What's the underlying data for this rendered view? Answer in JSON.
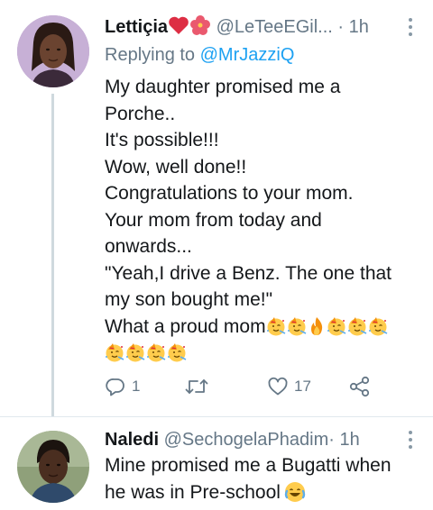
{
  "tweets": [
    {
      "author_name": "Lettiçia",
      "author_name_emojis": [
        "red-heart",
        "hibiscus"
      ],
      "handle": "@LeTeeEGil...",
      "dot": "·",
      "time": "1h",
      "reply_label": "Replying to",
      "reply_mention": "@MrJazziQ",
      "lines": [
        "My daughter promised me a",
        "Porche..",
        "It's possible!!!",
        "Wow, well done!!",
        "Congratulations to your mom.",
        "Your mom from today and",
        "onwards...",
        "\"Yeah,I drive a Benz. The one that",
        "my son bought me!\"",
        "What a proud mom"
      ],
      "line_end_emojis": [
        "partying-face",
        "partying-face",
        "fire",
        "partying-face",
        "partying-face",
        "partying-face"
      ],
      "emoji_row": [
        "partying-face",
        "partying-face",
        "partying-face",
        "partying-face"
      ],
      "actions": {
        "reply": {
          "icon": "reply-icon",
          "count": "1"
        },
        "retweet": {
          "icon": "retweet-icon",
          "count": ""
        },
        "like": {
          "icon": "heart-icon",
          "count": "17"
        },
        "share": {
          "icon": "share-icon",
          "count": ""
        }
      }
    },
    {
      "author_name": "Naledi",
      "handle": "@SechogelaPhadim",
      "dot": "·",
      "time": "1h",
      "lines": [
        "Mine promised me a Bugatti when",
        "he was in Pre-school"
      ],
      "line_end_emojis": [
        "face-with-tears-of-joy"
      ]
    }
  ],
  "colors": {
    "text": "#14171a",
    "secondary": "#657786",
    "mention": "#1da1f2",
    "divider": "#e1e8ed"
  }
}
